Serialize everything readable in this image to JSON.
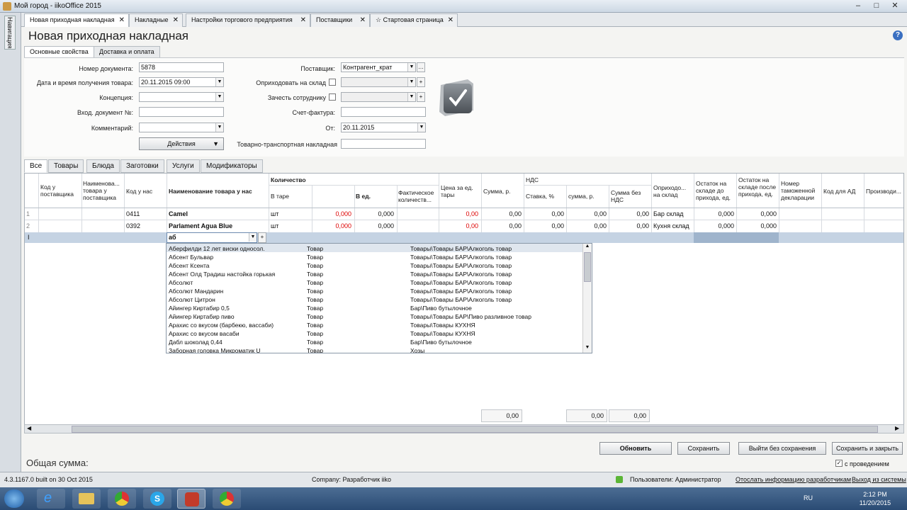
{
  "window": {
    "title": "Мой город - iikoOffice 2015"
  },
  "nav_rail": {
    "label": "Навигация"
  },
  "doc_tabs": [
    {
      "label": "Новая приходная накладная"
    },
    {
      "label": "Накладные"
    },
    {
      "label": "Настройки торгового предприятия"
    },
    {
      "label": "Поставщики"
    },
    {
      "label": "Стартовая страница"
    }
  ],
  "page_title": "Новая приходная накладная",
  "prop_tabs": [
    "Основные свойства",
    "Доставка и оплата"
  ],
  "form": {
    "doc_number_label": "Номер документа:",
    "doc_number": "5878",
    "date_label": "Дата и время получения товара:",
    "date": "20.11.2015 09:00",
    "concept_label": "Концепция:",
    "concept": "",
    "in_doc_label": "Вход. документ №:",
    "in_doc": "",
    "comment_label": "Комментарий:",
    "comment": "",
    "actions_label": "Действия",
    "supplier_label": "Поставщик:",
    "supplier": "Контрагент_крат",
    "warehouse_label": "Оприходовать на склад",
    "employee_label": "Зачесть сотруднику",
    "invoice_label": "Счет-фактура:",
    "invoice": "",
    "from_label": "От:",
    "from_date": "20.11.2015",
    "waybill_label": "Товарно-транспортная накладная",
    "waybill": ""
  },
  "grid_tabs": [
    "Все",
    "Товары",
    "Блюда",
    "Заготовки",
    "Услуги",
    "Модификаторы"
  ],
  "columns": {
    "supplier_code": "Код у поставщика",
    "supplier_name": "Наименова... товара у поставщика",
    "our_code": "Код у нас",
    "our_name": "Наименование товара у нас",
    "qty_group": "Количество",
    "in_pack": "В таре",
    "in_units": "В ед.",
    "actual_qty": "Фактическое количеств...",
    "price_pack": "Цена за ед. тары",
    "sum": "Сумма, р.",
    "vat_group": "НДС",
    "vat_rate": "Ставка, %",
    "vat_sum": "сумма, р.",
    "sum_no_vat": "Сумма без НДС",
    "to_stock": "Оприходо... на склад",
    "stock_before": "Остаток на складе до прихода, ед.",
    "stock_after": "Остаток на складе после прихода, ед.",
    "customs": "Номер таможенной декларации",
    "ad_code": "Код для АД",
    "producer": "Производи..."
  },
  "rows": [
    {
      "num": "1",
      "code": "0411",
      "name": "Camel",
      "pack": "шт",
      "pack_qty": "0,000",
      "units": "0,000",
      "price": "0,00",
      "sum": "0,00",
      "rate": "0,00",
      "vat": "0,00",
      "novat": "0,00",
      "stock": "Бар склад",
      "before": "0,000",
      "after": "0,000"
    },
    {
      "num": "2",
      "code": "0392",
      "name": "Parlament Agua Blue",
      "pack": "шт",
      "pack_qty": "0,000",
      "units": "0,000",
      "price": "0,00",
      "sum": "0,00",
      "rate": "0,00",
      "vat": "0,00",
      "novat": "0,00",
      "stock": "Кухня склад",
      "before": "0,000",
      "after": "0,000"
    }
  ],
  "edit_row": {
    "marker": "I",
    "search": "аб"
  },
  "suggestions": [
    {
      "name": "Аберфилди 12 лет виски односол.",
      "type": "Товар",
      "group": "Товары\\Товары БАР\\Алкоголь товар"
    },
    {
      "name": "Абсент Бульвар",
      "type": "Товар",
      "group": "Товары\\Товары БАР\\Алкоголь товар"
    },
    {
      "name": "Абсент Ксента",
      "type": "Товар",
      "group": "Товары\\Товары БАР\\Алкоголь товар"
    },
    {
      "name": "Абсент Олд Традиш настойка горькая",
      "type": "Товар",
      "group": "Товары\\Товары БАР\\Алкоголь товар"
    },
    {
      "name": "Абсолют",
      "type": "Товар",
      "group": "Товары\\Товары БАР\\Алкоголь товар"
    },
    {
      "name": "Абсолют Мандарин",
      "type": "Товар",
      "group": "Товары\\Товары БАР\\Алкоголь товар"
    },
    {
      "name": "Абсолют Цитрон",
      "type": "Товар",
      "group": "Товары\\Товары БАР\\Алкоголь товар"
    },
    {
      "name": "Айингер Киртабир 0,5",
      "type": "Товар",
      "group": "Бар\\Пиво бутылочное"
    },
    {
      "name": "Айингер Киртабир пиво",
      "type": "Товар",
      "group": "Товары\\Товары БАР\\Пиво разливное товар"
    },
    {
      "name": "Арахис со вкусом (барбекю, вассаби)",
      "type": "Товар",
      "group": "Товары\\Товары КУХНЯ"
    },
    {
      "name": "Арахис со вкусом васаби",
      "type": "Товар",
      "group": "Товары\\Товары КУХНЯ"
    },
    {
      "name": "Дабл шоколад 0,44",
      "type": "Товар",
      "group": "Бар\\Пиво бутылочное"
    },
    {
      "name": "Заборная головка Микроматик U",
      "type": "Товар",
      "group": "Хозы"
    }
  ],
  "totals": {
    "sum": "0,00",
    "vat": "0,00",
    "novat": "0,00"
  },
  "buttons": {
    "refresh": "Обновить",
    "save": "Сохранить",
    "exit": "Выйти без сохранения",
    "save_close": "Сохранить и закрыть",
    "post": "с проведением"
  },
  "total_label": "Общая сумма:",
  "status": {
    "build": "4.3.1167.0 built on 30 Oct 2015",
    "company": "Company: Разработчик iiko",
    "users": "Пользователи: Администратор",
    "send": "Отослать информацию разработчикам",
    "logout": "Выход из системы"
  },
  "taskbar": {
    "lang": "RU",
    "time": "2:12 PM",
    "date": "11/20/2015"
  }
}
